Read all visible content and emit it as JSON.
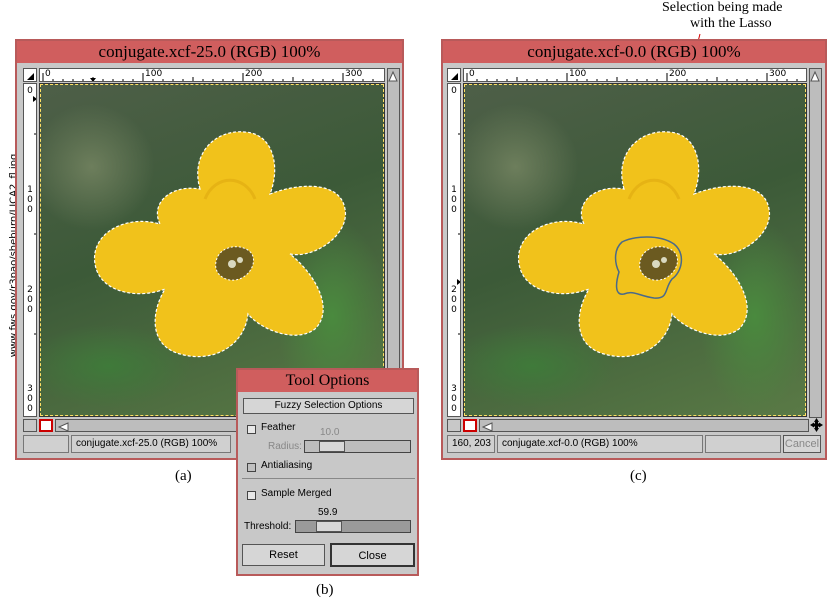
{
  "side_url": "www.fws.gov/r3pao/sheburn/LICA2_fl.jpg",
  "annotation": {
    "line1": "Selection being made",
    "line2": "with the Lasso"
  },
  "window_a": {
    "title": "conjugate.xcf-25.0 (RGB) 100%",
    "ruler_labels": [
      "0",
      "100",
      "200",
      "300"
    ],
    "vruler": [
      "0",
      "1\n0\n0",
      "2\n0\n0",
      "3\n0\n0"
    ],
    "status": "conjugate.xcf-25.0 (RGB) 100%",
    "caption": "(a)"
  },
  "window_c": {
    "title": "conjugate.xcf-0.0 (RGB) 100%",
    "ruler_labels": [
      "0",
      "100",
      "200",
      "300"
    ],
    "vruler": [
      "0",
      "1\n0\n0",
      "2\n0\n0",
      "3\n0\n0"
    ],
    "coords": "160, 203",
    "status": "conjugate.xcf-0.0 (RGB) 100%",
    "cancel": "Cancel",
    "caption": "(c)"
  },
  "tool_options": {
    "title": "Tool Options",
    "header": "Fuzzy Selection Options",
    "feather_label": "Feather",
    "radius_label": "Radius:",
    "radius_value": "10.0",
    "antialiasing_label": "Antialiasing",
    "sample_merged_label": "Sample Merged",
    "threshold_label": "Threshold:",
    "threshold_value": "59.9",
    "reset_label": "Reset",
    "close_label": "Close",
    "caption": "(b)"
  },
  "colors": {
    "title_bar": "#d05e5e",
    "petal": "#f1c21b",
    "lasso": "#4a6a8a"
  }
}
